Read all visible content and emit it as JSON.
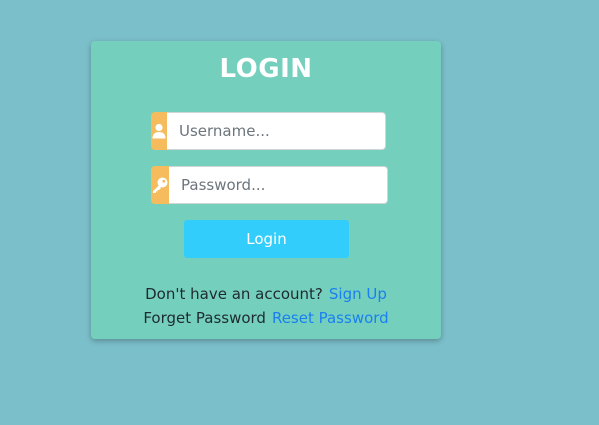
{
  "page": {
    "background_color": "#7bbfca"
  },
  "login_card": {
    "background_color": "#74d0bd",
    "title": "LOGIN",
    "username": {
      "icon": "user-icon",
      "placeholder": "Username...",
      "value": ""
    },
    "password": {
      "icon": "key-icon",
      "placeholder": "Password...",
      "value": ""
    },
    "addon_color": "#f6bb5c",
    "login_button": {
      "label": "Login",
      "color": "#33cdfc"
    },
    "signup_prompt": {
      "text": "Don't have an account?",
      "link_label": "Sign Up"
    },
    "reset_prompt": {
      "text": "Forget Password",
      "link_label": "Reset Password"
    },
    "link_color": "#1a7ff0"
  }
}
